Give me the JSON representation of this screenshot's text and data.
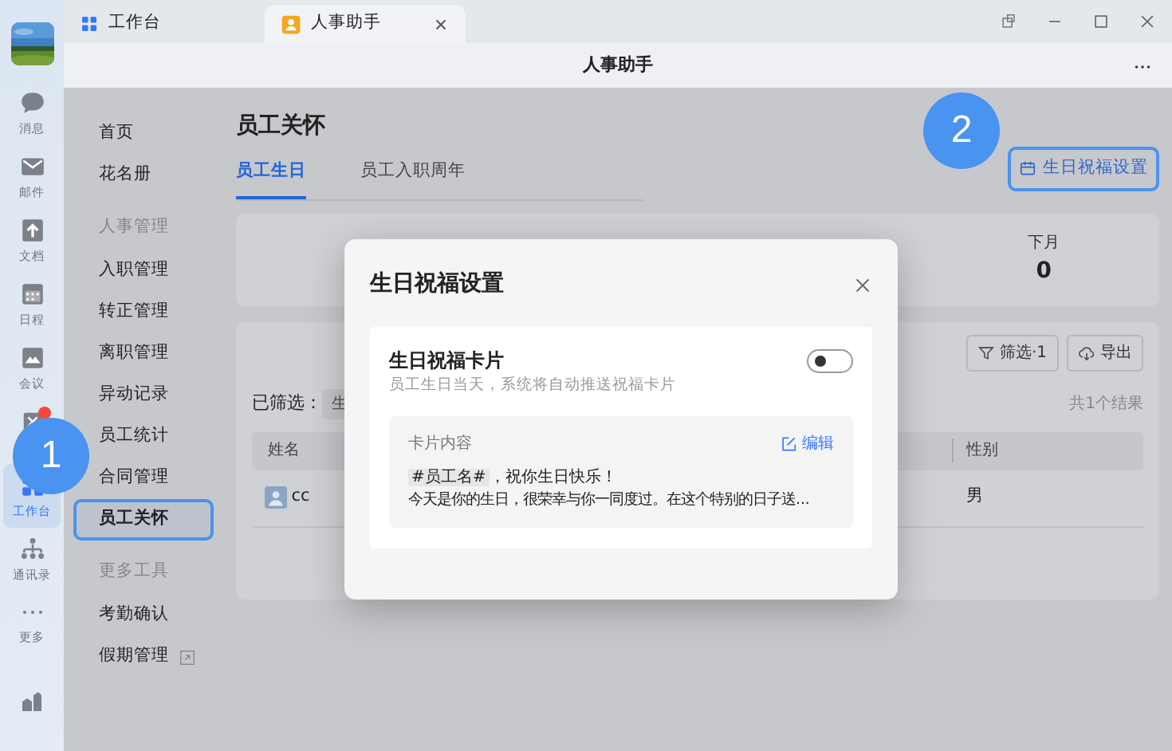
{
  "rail": {
    "items": [
      {
        "label": "消息",
        "selected": false,
        "badge": false
      },
      {
        "label": "邮件",
        "selected": false,
        "badge": false
      },
      {
        "label": "文档",
        "selected": false,
        "badge": false
      },
      {
        "label": "日程",
        "selected": false,
        "badge": false
      },
      {
        "label": "会议",
        "selected": false,
        "badge": false
      },
      {
        "selected": false,
        "badge": true
      },
      {
        "label": "工作台",
        "selected": true,
        "badge": false
      },
      {
        "label": "通讯录",
        "selected": false,
        "badge": false
      },
      {
        "label": "更多",
        "selected": false,
        "badge": false
      }
    ]
  },
  "tabs": [
    {
      "label": "工作台",
      "selected": false,
      "closable": false
    },
    {
      "label": "人事助手",
      "selected": true,
      "closable": true
    }
  ],
  "header": {
    "title": "人事助手"
  },
  "nav": {
    "items": [
      {
        "kind": "link",
        "label": "首页",
        "selected": false
      },
      {
        "kind": "link",
        "label": "花名册",
        "selected": false
      },
      {
        "kind": "group",
        "label": "人事管理"
      },
      {
        "kind": "link",
        "label": "入职管理",
        "selected": false
      },
      {
        "kind": "link",
        "label": "转正管理",
        "selected": false
      },
      {
        "kind": "link",
        "label": "离职管理",
        "selected": false
      },
      {
        "kind": "link",
        "label": "异动记录",
        "selected": false
      },
      {
        "kind": "link",
        "label": "员工统计",
        "selected": false
      },
      {
        "kind": "link",
        "label": "合同管理",
        "selected": false
      },
      {
        "kind": "link",
        "label": "员工关怀",
        "selected": true,
        "highlighted": true
      },
      {
        "kind": "group",
        "label": "更多工具"
      },
      {
        "kind": "link",
        "label": "考勤确认",
        "selected": false
      },
      {
        "kind": "link",
        "label": "假期管理",
        "selected": false,
        "external": true
      }
    ]
  },
  "page": {
    "title": "员工关怀",
    "tabs": [
      {
        "label": "员工生日",
        "selected": true
      },
      {
        "label": "员工入职周年",
        "selected": false
      }
    ],
    "action": {
      "label": "生日祝福设置",
      "highlighted": true
    }
  },
  "stats": [
    {
      "label": "下月",
      "value": "0"
    }
  ],
  "toolbar": {
    "filter": "筛选·1",
    "export": "导出"
  },
  "filters": {
    "label": "已筛选：",
    "chips": [
      "生"
    ],
    "result_count": "共1个结果"
  },
  "table": {
    "columns": [
      "姓名",
      "性别"
    ],
    "rows": [
      {
        "name": "cc",
        "gender": "男"
      }
    ]
  },
  "modal": {
    "title": "生日祝福设置",
    "setting": {
      "title": "生日祝福卡片",
      "description": "员工生日当天，系统将自动推送祝福卡片",
      "on": false
    },
    "card": {
      "label": "卡片内容",
      "edit": "编辑",
      "tag": "#员工名#",
      "greeting": "，祝你生日快乐！",
      "message": "今天是你的生日，很荣幸与你一同度过。在这个特别的日子送..."
    }
  },
  "annotations": [
    {
      "label": "1"
    },
    {
      "label": "2"
    }
  ]
}
